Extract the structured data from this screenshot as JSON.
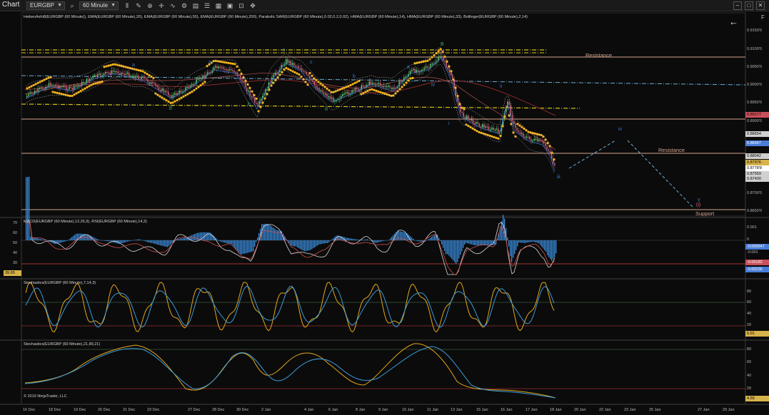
{
  "toolbar": {
    "chart_label": "Chart",
    "instrument": "EURGBP",
    "interval": "60 Minute",
    "icons": [
      "search-icon",
      "bar-style-icon",
      "drawing-tool-icon",
      "zoom-icon",
      "crosshair-icon",
      "indicators-icon",
      "strategy-icon",
      "templates-icon",
      "properties-icon",
      "panel-icon",
      "data-box-icon",
      "lock-icon",
      "pan-icon"
    ],
    "window_buttons": [
      "minimize",
      "maximize",
      "close"
    ]
  },
  "panels": {
    "price": {
      "indicator_label": "HeikenAshi8(EURGBP (60 Minute)), EMA(EURGBP (60 Minute),20), EMA(EURGBP (60 Minute),50), EMA(EURGBP (60 Minute),200), Parabolic SAR(EURGBP (60 Minute),0.02,0.2,0.02), HMA(EURGBP (60 Minute),14), HMA(EURGBP (60 Minute),33), Bollinger(EURGBP (60 Minute),2,14)",
      "axis_labels": [
        "0.9150'0",
        "0.9100'0",
        "0.9050'0",
        "0.9000'0",
        "0.8950'0",
        "0.8900'0",
        "0.8700'0",
        "0.8650'0"
      ],
      "price_tags": [
        {
          "text": "0.89177",
          "color": "#c8505a"
        },
        {
          "text": "0.88654",
          "color": "#d0d0d0"
        },
        {
          "text": "0.88497",
          "color": "#4a7dd8"
        },
        {
          "text": "0.88042",
          "color": "#d0d0d0"
        },
        {
          "text": "0.87976",
          "color": "#d6b24a"
        },
        {
          "text": "0.8778'8",
          "color": "#ffffff"
        },
        {
          "text": "0.87559",
          "color": "#d0d0d0"
        },
        {
          "text": "0.87430",
          "color": "#d0d0d0"
        }
      ],
      "levels": [
        {
          "label": "Resistance",
          "color": "#d6a48e"
        },
        {
          "label": "Resistance",
          "color": "#d6a48e"
        },
        {
          "label": "Support",
          "color": "#d6a48e"
        }
      ],
      "wave_labels": [
        "a",
        "b",
        "c",
        "a",
        "b",
        "c",
        "d",
        "b",
        "a",
        "B",
        "(c)",
        "iv",
        "i",
        "ii",
        "iii",
        "iv",
        "v",
        "(i)"
      ]
    },
    "macd": {
      "indicator_label": "MACD(EURGBP (60 Minute),12,26,9), RSI(EURGBP (60 Minute),14,3)",
      "left_axis": [
        "70",
        "60",
        "50",
        "40",
        "30"
      ],
      "left_tag": "39.95",
      "right_axis": [
        "0.001",
        "0",
        "-0.001"
      ],
      "price_tags": [
        {
          "text": "-0.000547",
          "color": "#4a7dd8"
        },
        {
          "text": "-0.00182",
          "color": "#c8505a"
        },
        {
          "text": "-0.00236",
          "color": "#4a7dd8"
        }
      ]
    },
    "stoch1": {
      "indicator_label": "Stochastics(EURGBP (60 Minute),7,14,3)",
      "axis_labels": [
        "80",
        "60",
        "40",
        "20"
      ],
      "tag": "6.01"
    },
    "stoch2": {
      "indicator_label": "Stochastics(EURGBP (60 Minute),21,89,21)",
      "axis_labels": [
        "80",
        "60",
        "40",
        "20"
      ],
      "tag": "4.59",
      "copyright": "© 2019 NinjaTrader, LLC"
    }
  },
  "x_axis": [
    "16 Dec",
    "18 Dec",
    "19 Dec",
    "20 Dec",
    "21 Dec",
    "23 Dec",
    "27 Dec",
    "28 Dec",
    "30 Dec",
    "2 Jan",
    "4 Jan",
    "6 Jan",
    "8 Jan",
    "9 Jan",
    "10 Jan",
    "11 Jan",
    "13 Jan",
    "15 Jan",
    "16 Jan",
    "17 Jan",
    "18 Jan",
    "20 Jan",
    "22 Jan",
    "23 Jan",
    "25 Jan",
    "27 Jan",
    "29 Jan"
  ],
  "side_key": "F",
  "colors": {
    "background": "#0b0b0b",
    "candle_up": "#6bd47a",
    "candle_down": "#d86a86",
    "sar": "#f2b21c",
    "ema": "#8a2a2a",
    "hma": "#3b7ad8",
    "stoch_k": "#e2a81a",
    "stoch_d": "#3b9ad8",
    "level_line": "#d6a48e",
    "fib_line": "#d4c31a",
    "trend_line": "#6aaed8"
  }
}
